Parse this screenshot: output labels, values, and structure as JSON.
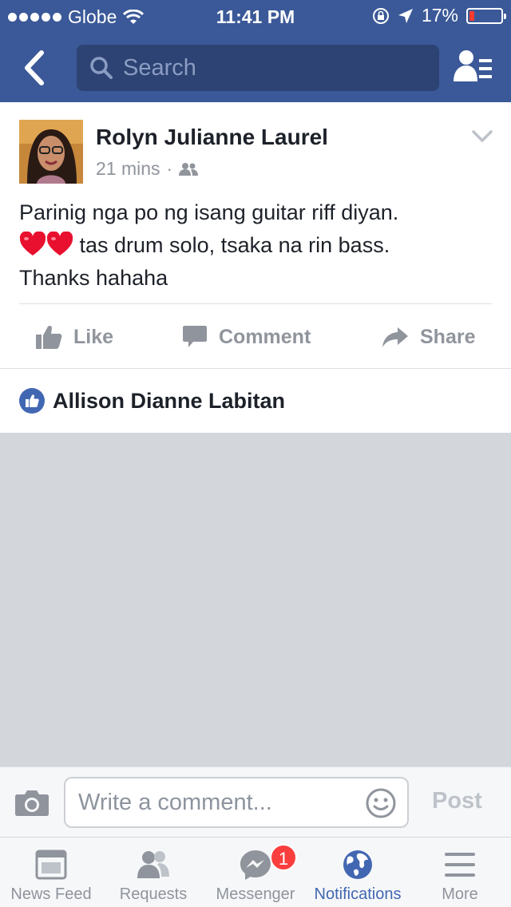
{
  "status_bar": {
    "carrier": "Globe",
    "time": "11:41 PM",
    "battery": "17%",
    "battery_level": 0.17
  },
  "header": {
    "search_placeholder": "Search",
    "colors": {
      "brand": "#3b5998",
      "search_bg": "#2d4373"
    }
  },
  "post": {
    "author": "Rolyn Julianne Laurel",
    "time_ago": "21 mins",
    "separator": "·",
    "privacy_icon": "friends-icon",
    "text_line1": "Parinig nga po ng isang guitar riff diyan.",
    "text_line2": "tas drum solo, tsaka na rin bass.",
    "text_line3": "Thanks hahaha",
    "emoji": "heart",
    "actions": {
      "like": "Like",
      "comment": "Comment",
      "share": "Share"
    }
  },
  "likes": {
    "name": "Allison Dianne Labitan"
  },
  "composer": {
    "placeholder": "Write a comment...",
    "post_label": "Post"
  },
  "tabs": [
    {
      "label": "News Feed",
      "icon": "news-feed-icon"
    },
    {
      "label": "Requests",
      "icon": "requests-icon"
    },
    {
      "label": "Messenger",
      "icon": "messenger-icon",
      "badge": "1"
    },
    {
      "label": "Notifications",
      "icon": "globe-icon",
      "active": true
    },
    {
      "label": "More",
      "icon": "menu-icon"
    }
  ]
}
